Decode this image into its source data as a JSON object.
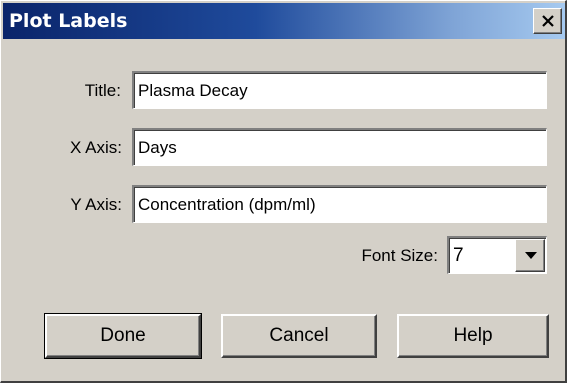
{
  "window": {
    "title": "Plot Labels",
    "close_symbol": "×"
  },
  "form": {
    "title_label": "Title:",
    "title_value": "Plasma Decay",
    "x_axis_label": "X Axis:",
    "x_axis_value": "Days",
    "y_axis_label": "Y Axis:",
    "y_axis_value": "Concentration (dpm/ml)",
    "font_size_label": "Font Size:",
    "font_size_value": "7"
  },
  "buttons": {
    "done": "Done",
    "cancel": "Cancel",
    "help": "Help"
  },
  "icons": {
    "close": "close-icon",
    "dropdown": "chevron-down-icon"
  },
  "colors": {
    "dialog_bg": "#d4d0c8",
    "titlebar_start": "#0a246a",
    "titlebar_end": "#a6caf0",
    "field_bg": "#ffffff"
  }
}
